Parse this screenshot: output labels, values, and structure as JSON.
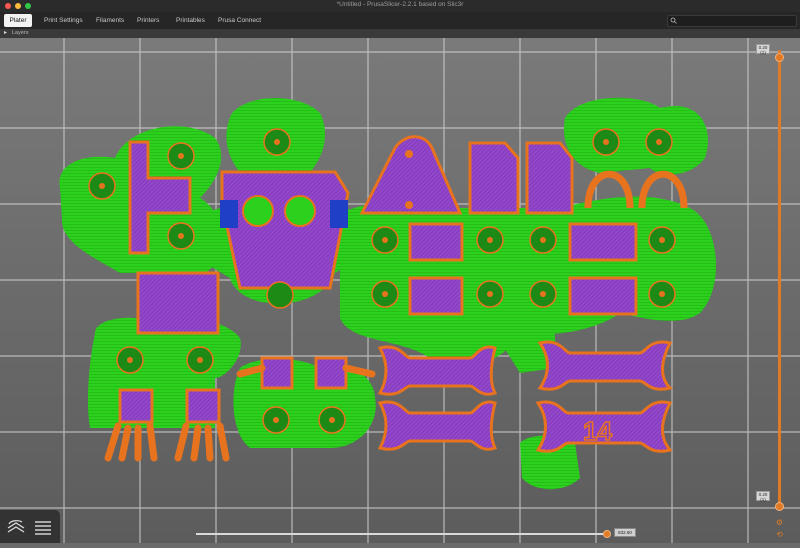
{
  "window": {
    "title": "*Untitled - PrusaSlicer-2.2.1 based on Slic3r"
  },
  "traffic_lights": {
    "close": "#fc5753",
    "minimize": "#fdbc40",
    "zoom": "#33c748"
  },
  "tabs": [
    {
      "label": "Plater",
      "active": true
    },
    {
      "label": "Print Settings",
      "active": false
    },
    {
      "label": "Filaments",
      "active": false
    },
    {
      "label": "Printers",
      "active": false
    },
    {
      "label": "Printables",
      "active": false
    },
    {
      "label": "Prusa Connect",
      "active": false
    }
  ],
  "object_bar": {
    "label": "Layers"
  },
  "sliders": {
    "vertical_top_label": "0.20 (1)",
    "vertical_bottom_label": "0.20 (1)",
    "horizontal_label": "832.60"
  },
  "plate_text": "14",
  "colors": {
    "background": "#6b6b6b",
    "infill_green": "#2bd11c",
    "perimeter_orange": "#e8731e",
    "inner_purple": "#8a3fc2",
    "accent_orange": "#e07a24"
  },
  "icons": [
    "search-icon",
    "layers-view-icon",
    "legend-icon",
    "gear-icon",
    "settings-icon"
  ]
}
